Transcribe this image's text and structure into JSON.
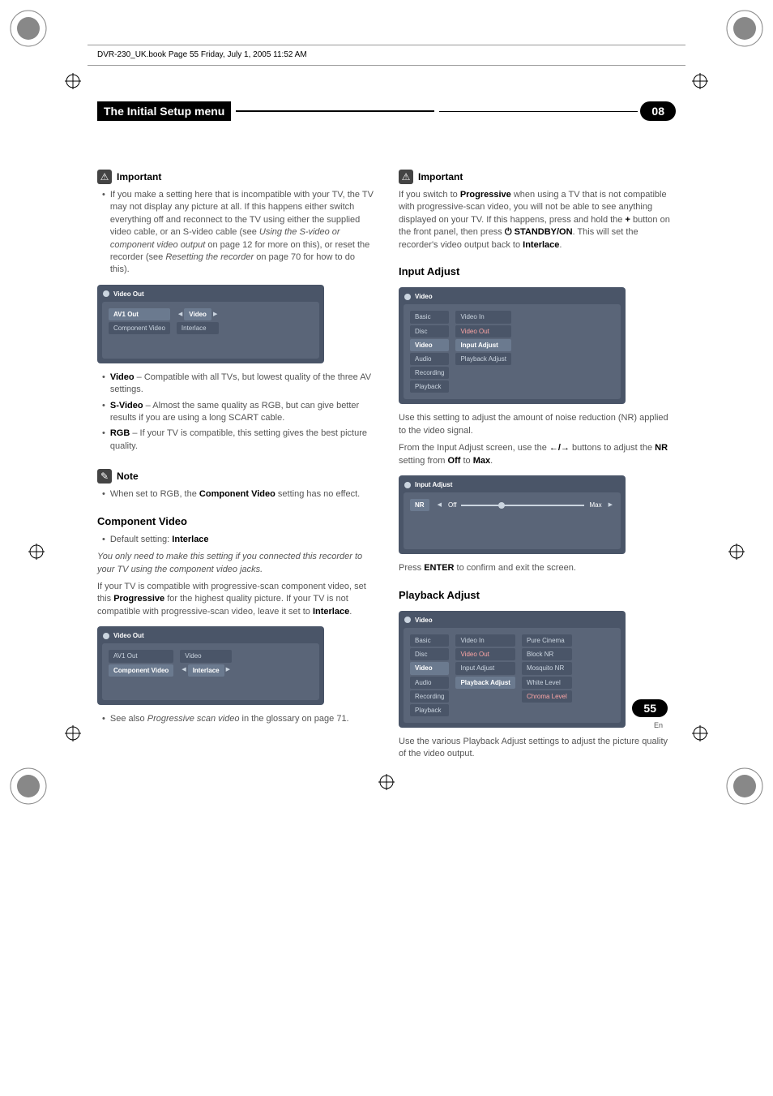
{
  "book_header": "DVR-230_UK.book  Page 55  Friday, July 1, 2005  11:52 AM",
  "title_bar": {
    "title": "The Initial Setup menu",
    "chapter": "08"
  },
  "left": {
    "important_label": "Important",
    "important_bullet": "If you make a setting here that is incompatible with your TV, the TV may not display any picture at all. If this happens either switch everything off and reconnect to the TV using either the supplied video cable, or an S-video cable (see ",
    "important_italic1": "Using the S-video or component video output",
    "important_mid": " on page 12 for more on this), or reset the recorder (see ",
    "important_italic2": "Resetting the recorder",
    "important_end": " on page 70 for how to do this).",
    "menu1": {
      "title": "Video Out",
      "sidebar": [
        "AV1 Out",
        "Component Video"
      ],
      "values": [
        "Video",
        "Interlace"
      ]
    },
    "bullets": [
      {
        "bold": "Video",
        "rest": " – Compatible with all TVs, but lowest quality of the three AV settings."
      },
      {
        "bold": "S-Video",
        "rest": " – Almost the same quality as RGB, but can give better results if you are using a long SCART cable."
      },
      {
        "bold": "RGB",
        "rest": " – If your TV is compatible, this setting gives the best picture quality."
      }
    ],
    "note_label": "Note",
    "note_text_pre": "When set to RGB, the ",
    "note_bold": "Component Video",
    "note_text_post": " setting has no effect.",
    "comp_video_head": "Component Video",
    "default_pre": "Default setting: ",
    "default_bold": "Interlace",
    "comp_italic": "You only need to make this setting if you connected this recorder to your TV using the component video jacks.",
    "comp_p1_pre": "If your TV is compatible with progressive-scan component video, set this ",
    "comp_p1_bold1": "Progressive",
    "comp_p1_mid": " for the highest quality picture. If your TV is not compatible with progressive-scan video, leave it set to ",
    "comp_p1_bold2": "Interlace",
    "comp_p1_end": ".",
    "menu2": {
      "title": "Video Out",
      "sidebar": [
        "AV1 Out",
        "Component Video"
      ],
      "values": [
        "Video",
        "Interlace"
      ]
    },
    "seealso_pre": "See also ",
    "seealso_italic": "Progressive scan video",
    "seealso_post": " in the glossary on page 71."
  },
  "right": {
    "important_label": "Important",
    "imp_pre": "If you switch to ",
    "imp_bold1": "Progressive",
    "imp_mid1": " when using a TV that is not compatible with progressive-scan video, you will not be able to see anything displayed on your TV. If this happens, press and hold the ",
    "imp_plus": "+",
    "imp_mid2": " button on the front panel, then press ",
    "imp_power": "⏻",
    "imp_bold2": " STANDBY/ON",
    "imp_mid3": ". This will set the recorder's video output back to ",
    "imp_bold3": "Interlace",
    "imp_end": ".",
    "input_adjust_head": "Input Adjust",
    "menu3": {
      "title": "Video",
      "sidebar": [
        "Basic",
        "Disc",
        "Video",
        "Audio",
        "Recording",
        "Playback"
      ],
      "values": [
        "Video In",
        "Video Out",
        "Input Adjust",
        "Playback Adjust"
      ]
    },
    "ia_p1": "Use this setting to adjust the amount of noise reduction (NR) applied to the video signal.",
    "ia_p2_pre": "From the Input Adjust screen, use the ",
    "ia_p2_arrows": "←/→",
    "ia_p2_mid": " buttons to adjust the ",
    "ia_p2_bold1": "NR",
    "ia_p2_mid2": " setting from ",
    "ia_p2_bold2": "Off",
    "ia_p2_mid3": " to ",
    "ia_p2_bold3": "Max",
    "ia_p2_end": ".",
    "menu4": {
      "title": "Input Adjust",
      "nr_label": "NR",
      "off": "Off",
      "max": "Max"
    },
    "press_pre": "Press ",
    "press_bold": "ENTER",
    "press_post": " to confirm and exit the screen.",
    "playback_adjust_head": "Playback Adjust",
    "menu5": {
      "title": "Video",
      "sidebar": [
        "Basic",
        "Disc",
        "Video",
        "Audio",
        "Recording",
        "Playback"
      ],
      "values": [
        "Video In",
        "Video Out",
        "Input Adjust",
        "Playback Adjust"
      ],
      "third": [
        "Pure Cinema",
        "Block NR",
        "Mosquito NR",
        "White Level",
        "Chroma Level"
      ]
    },
    "pa_p1": "Use the various Playback Adjust settings to adjust the picture quality of the video output."
  },
  "page_num": "55",
  "page_lang": "En"
}
